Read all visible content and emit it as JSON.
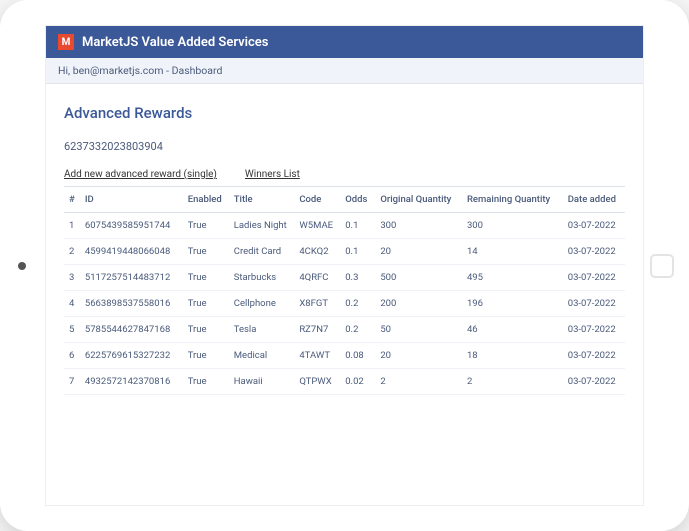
{
  "header": {
    "logo_letter": "M",
    "title": "MarketJS Value Added Services"
  },
  "subheader": {
    "greeting": "Hi, ben@marketjs.com - Dashboard"
  },
  "page": {
    "title": "Advanced Rewards",
    "record_id": "6237332023803904"
  },
  "actions": {
    "add_link": "Add new advanced reward (single)",
    "winners_link": "Winners List"
  },
  "table": {
    "headers": {
      "num": "#",
      "id": "ID",
      "enabled": "Enabled",
      "title": "Title",
      "code": "Code",
      "odds": "Odds",
      "orig_qty": "Original Quantity",
      "rem_qty": "Remaining Quantity",
      "date": "Date added"
    },
    "rows": [
      {
        "num": "1",
        "id": "6075439585951744",
        "enabled": "True",
        "title": "Ladies Night",
        "code": "W5MAE",
        "odds": "0.1",
        "orig_qty": "300",
        "rem_qty": "300",
        "date": "03-07-2022"
      },
      {
        "num": "2",
        "id": "4599419448066048",
        "enabled": "True",
        "title": "Credit Card",
        "code": "4CKQ2",
        "odds": "0.1",
        "orig_qty": "20",
        "rem_qty": "14",
        "date": "03-07-2022"
      },
      {
        "num": "3",
        "id": "5117257514483712",
        "enabled": "True",
        "title": "Starbucks",
        "code": "4QRFC",
        "odds": "0.3",
        "orig_qty": "500",
        "rem_qty": "495",
        "date": "03-07-2022"
      },
      {
        "num": "4",
        "id": "5663898537558016",
        "enabled": "True",
        "title": "Cellphone",
        "code": "X8FGT",
        "odds": "0.2",
        "orig_qty": "200",
        "rem_qty": "196",
        "date": "03-07-2022"
      },
      {
        "num": "5",
        "id": "5785544627847168",
        "enabled": "True",
        "title": "Tesla",
        "code": "RZ7N7",
        "odds": "0.2",
        "orig_qty": "50",
        "rem_qty": "46",
        "date": "03-07-2022"
      },
      {
        "num": "6",
        "id": "6225769615327232",
        "enabled": "True",
        "title": "Medical",
        "code": "4TAWT",
        "odds": "0.08",
        "orig_qty": "20",
        "rem_qty": "18",
        "date": "03-07-2022"
      },
      {
        "num": "7",
        "id": "4932572142370816",
        "enabled": "True",
        "title": "Hawaii",
        "code": "QTPWX",
        "odds": "0.02",
        "orig_qty": "2",
        "rem_qty": "2",
        "date": "03-07-2022"
      }
    ]
  }
}
